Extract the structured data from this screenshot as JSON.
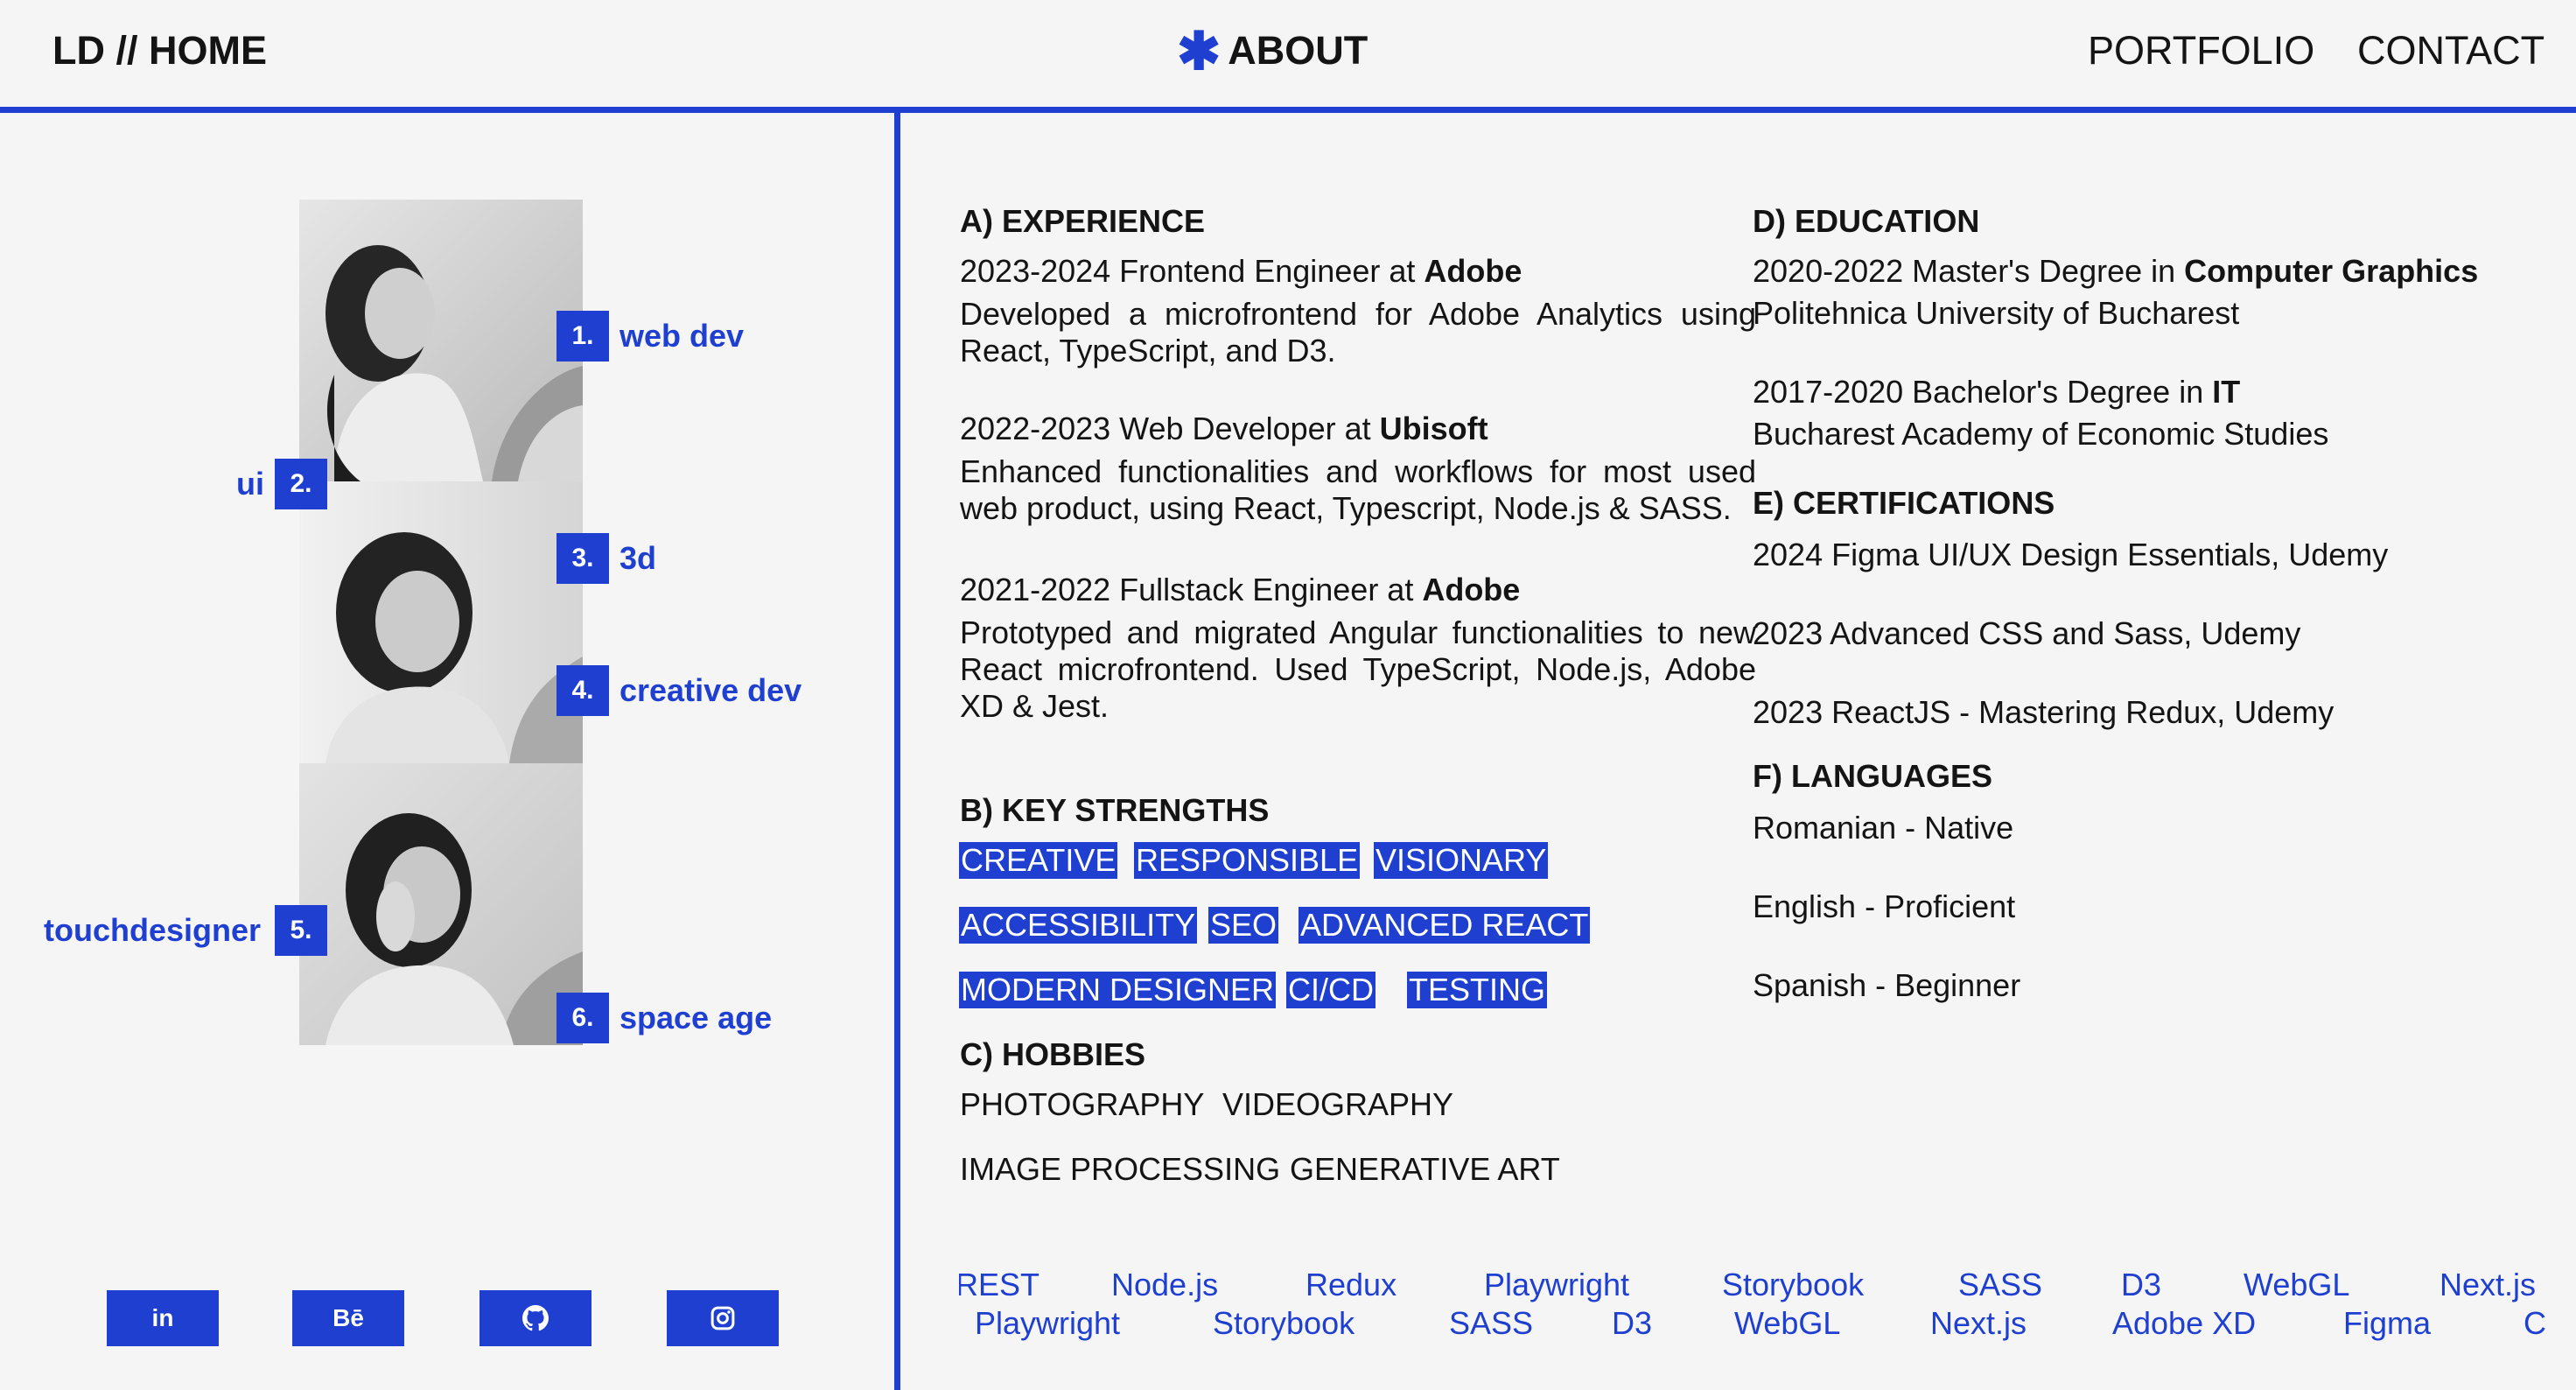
{
  "nav": {
    "home": "LD // HOME",
    "about": "ABOUT",
    "about_icon": "asterisk-icon",
    "portfolio": "PORTFOLIO",
    "contact": "CONTACT"
  },
  "tags": [
    {
      "num": "1.",
      "label": "web dev"
    },
    {
      "num": "2.",
      "label": "ui"
    },
    {
      "num": "3.",
      "label": "3d"
    },
    {
      "num": "4.",
      "label": "creative dev"
    },
    {
      "num": "5.",
      "label": "touchdesigner"
    },
    {
      "num": "6.",
      "label": "space age"
    }
  ],
  "social": [
    {
      "icon": "linkedin-icon",
      "text": "in"
    },
    {
      "icon": "behance-icon",
      "text": "Bē"
    },
    {
      "icon": "github-icon",
      "text": ""
    },
    {
      "icon": "instagram-icon",
      "text": ""
    }
  ],
  "experience": {
    "heading": "A) EXPERIENCE",
    "items": [
      {
        "role": "2023-2024 Frontend Engineer at ",
        "company": "Adobe",
        "desc": "Developed a microfrontend for Adobe Analytics using React, TypeScript, and D3."
      },
      {
        "role": "2022-2023 Web Developer at ",
        "company": "Ubisoft",
        "desc": "Enhanced functionalities and workflows for most used web product, using React, Typescript, Node.js & SASS."
      },
      {
        "role": "2021-2022 Fullstack Engineer at ",
        "company": "Adobe",
        "desc": "Prototyped and migrated Angular functionalities to new React microfrontend. Used TypeScript, Node.js, Adobe XD & Jest."
      }
    ]
  },
  "strengths": {
    "heading": "B) KEY STRENGTHS",
    "chips": [
      "CREATIVE",
      "RESPONSIBLE",
      "VISIONARY",
      "ACCESSIBILITY",
      "SEO",
      "ADVANCED REACT",
      "MODERN DESIGNER",
      "CI/CD",
      "TESTING"
    ]
  },
  "hobbies": {
    "heading": "C) HOBBIES",
    "items": [
      "PHOTOGRAPHY",
      "VIDEOGRAPHY",
      "IMAGE PROCESSING",
      "GENERATIVE ART"
    ]
  },
  "education": {
    "heading": "D) EDUCATION",
    "items": [
      {
        "degree": "2020-2022 Master's Degree in ",
        "field": "Computer Graphics",
        "school": "Politehnica University of Bucharest"
      },
      {
        "degree": "2017-2020 Bachelor's Degree in ",
        "field": "IT",
        "school": "Bucharest Academy of Economic Studies"
      }
    ]
  },
  "certifications": {
    "heading": "E) CERTIFICATIONS",
    "items": [
      "2024 Figma UI/UX Design Essentials, Udemy",
      "2023 Advanced CSS and Sass, Udemy",
      "2023 ReactJS - Mastering Redux, Udemy"
    ]
  },
  "languages": {
    "heading": "F) LANGUAGES",
    "items": [
      "Romanian - Native",
      "English - Proficient",
      "Spanish - Beginner"
    ]
  },
  "ticker": {
    "row1": [
      "REST",
      "Node.js",
      "Redux",
      "Playwright",
      "Storybook",
      "SASS",
      "D3",
      "WebGL",
      "Next.js"
    ],
    "row2": [
      "Playwright",
      "Storybook",
      "SASS",
      "D3",
      "WebGL",
      "Next.js",
      "Adobe XD",
      "Figma",
      "C"
    ]
  },
  "colors": {
    "accent": "#1e3fd0",
    "background": "#f5f5f5"
  }
}
